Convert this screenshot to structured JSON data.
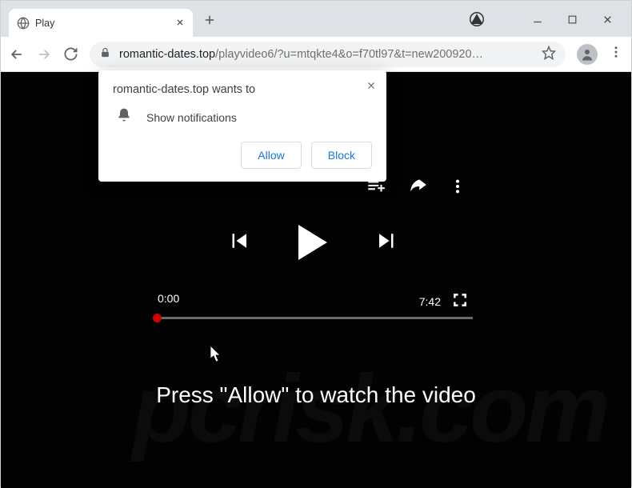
{
  "window": {
    "tab_title": "Play"
  },
  "address": {
    "domain": "romantic-dates.top",
    "path": "/playvideo6/?u=mtqkte4&o=f70tl97&t=new200920…"
  },
  "prompt": {
    "origin_text": "romantic-dates.top wants to",
    "permission_label": "Show notifications",
    "allow_label": "Allow",
    "block_label": "Block"
  },
  "player": {
    "current_time": "0:00",
    "duration": "7:42"
  },
  "page": {
    "instruction": "Press \"Allow\" to watch the video"
  }
}
